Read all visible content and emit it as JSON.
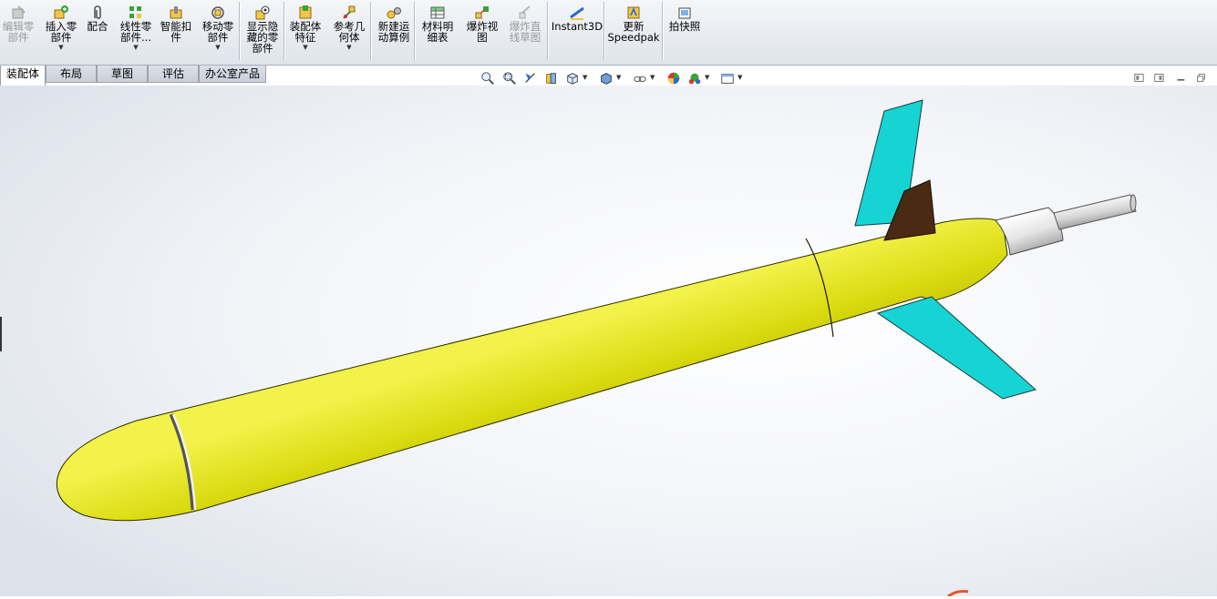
{
  "toolbar": {
    "buttons": [
      {
        "id": "edit-component",
        "label": "编辑零\n部件",
        "icon": "edit-component-icon",
        "enabled": false,
        "dropdown": false
      },
      {
        "id": "insert-components",
        "label": "插入零\n部件",
        "icon": "insert-component-icon",
        "enabled": true,
        "dropdown": true
      },
      {
        "id": "mate",
        "label": "配合",
        "icon": "paperclip-mate-icon",
        "enabled": true,
        "dropdown": false
      },
      {
        "id": "linear-pattern",
        "label": "线性零\n部件...",
        "icon": "linear-pattern-icon",
        "enabled": true,
        "dropdown": true
      },
      {
        "id": "smart-fasteners",
        "label": "智能扣\n件",
        "icon": "smart-fastener-icon",
        "enabled": true,
        "dropdown": false
      },
      {
        "id": "move-component",
        "label": "移动零\n部件",
        "icon": "move-component-icon",
        "enabled": true,
        "dropdown": true
      },
      {
        "id": "show-hidden",
        "label": "显示隐\n藏的零\n部件",
        "icon": "show-hidden-components-icon",
        "enabled": true,
        "dropdown": false
      },
      {
        "id": "assembly-features",
        "label": "装配体\n特征",
        "icon": "assembly-feature-icon",
        "enabled": true,
        "dropdown": true
      },
      {
        "id": "reference-geometry",
        "label": "参考几\n何体",
        "icon": "reference-geometry-icon",
        "enabled": true,
        "dropdown": true
      },
      {
        "id": "new-motion-study",
        "label": "新建运\n动算例",
        "icon": "motion-study-icon",
        "enabled": true,
        "dropdown": false
      },
      {
        "id": "bill-of-materials",
        "label": "材料明\n细表",
        "icon": "bom-table-icon",
        "enabled": true,
        "dropdown": false
      },
      {
        "id": "exploded-view",
        "label": "爆炸视\n图",
        "icon": "exploded-view-icon",
        "enabled": true,
        "dropdown": false
      },
      {
        "id": "explode-line-sketch",
        "label": "爆炸直\n线草图",
        "icon": "explode-line-sketch-icon",
        "enabled": false,
        "dropdown": false
      },
      {
        "id": "instant3d",
        "label": "Instant3D",
        "icon": "instant3d-icon",
        "enabled": true,
        "dropdown": false
      },
      {
        "id": "update-speedpak",
        "label": "更新\nSpeedpak",
        "icon": "speedpak-icon",
        "enabled": true,
        "dropdown": false
      },
      {
        "id": "take-snapshot",
        "label": "拍快照",
        "icon": "snapshot-icon",
        "enabled": true,
        "dropdown": false
      }
    ]
  },
  "tabs": [
    {
      "label": "装配体",
      "active": true
    },
    {
      "label": "布局",
      "active": false
    },
    {
      "label": "草图",
      "active": false
    },
    {
      "label": "评估",
      "active": false
    },
    {
      "label": "办公室产品",
      "active": false
    }
  ],
  "view_toolbar": [
    {
      "name": "zoom-to-fit-icon",
      "dropdown": false
    },
    {
      "name": "zoom-to-area-icon",
      "dropdown": false
    },
    {
      "name": "previous-view-icon",
      "dropdown": false
    },
    {
      "name": "section-view-icon",
      "dropdown": false
    },
    {
      "name": "view-orientation-icon",
      "dropdown": true
    },
    {
      "name": "display-style-icon",
      "dropdown": true
    },
    {
      "name": "hide-show-items-icon",
      "dropdown": true
    },
    {
      "name": "edit-appearance-icon",
      "dropdown": false
    },
    {
      "name": "apply-scene-icon",
      "dropdown": true
    },
    {
      "name": "view-settings-icon",
      "dropdown": true
    }
  ],
  "window_controls": [
    "tile-left-icon",
    "tile-right-icon",
    "minimize-icon",
    "restore-icon"
  ],
  "model": {
    "body_color": "#d2d200",
    "fin_color": "#17d4d4",
    "fin_dark_color": "#4a2a12",
    "tail_cap_color": "#e8e8e8"
  }
}
